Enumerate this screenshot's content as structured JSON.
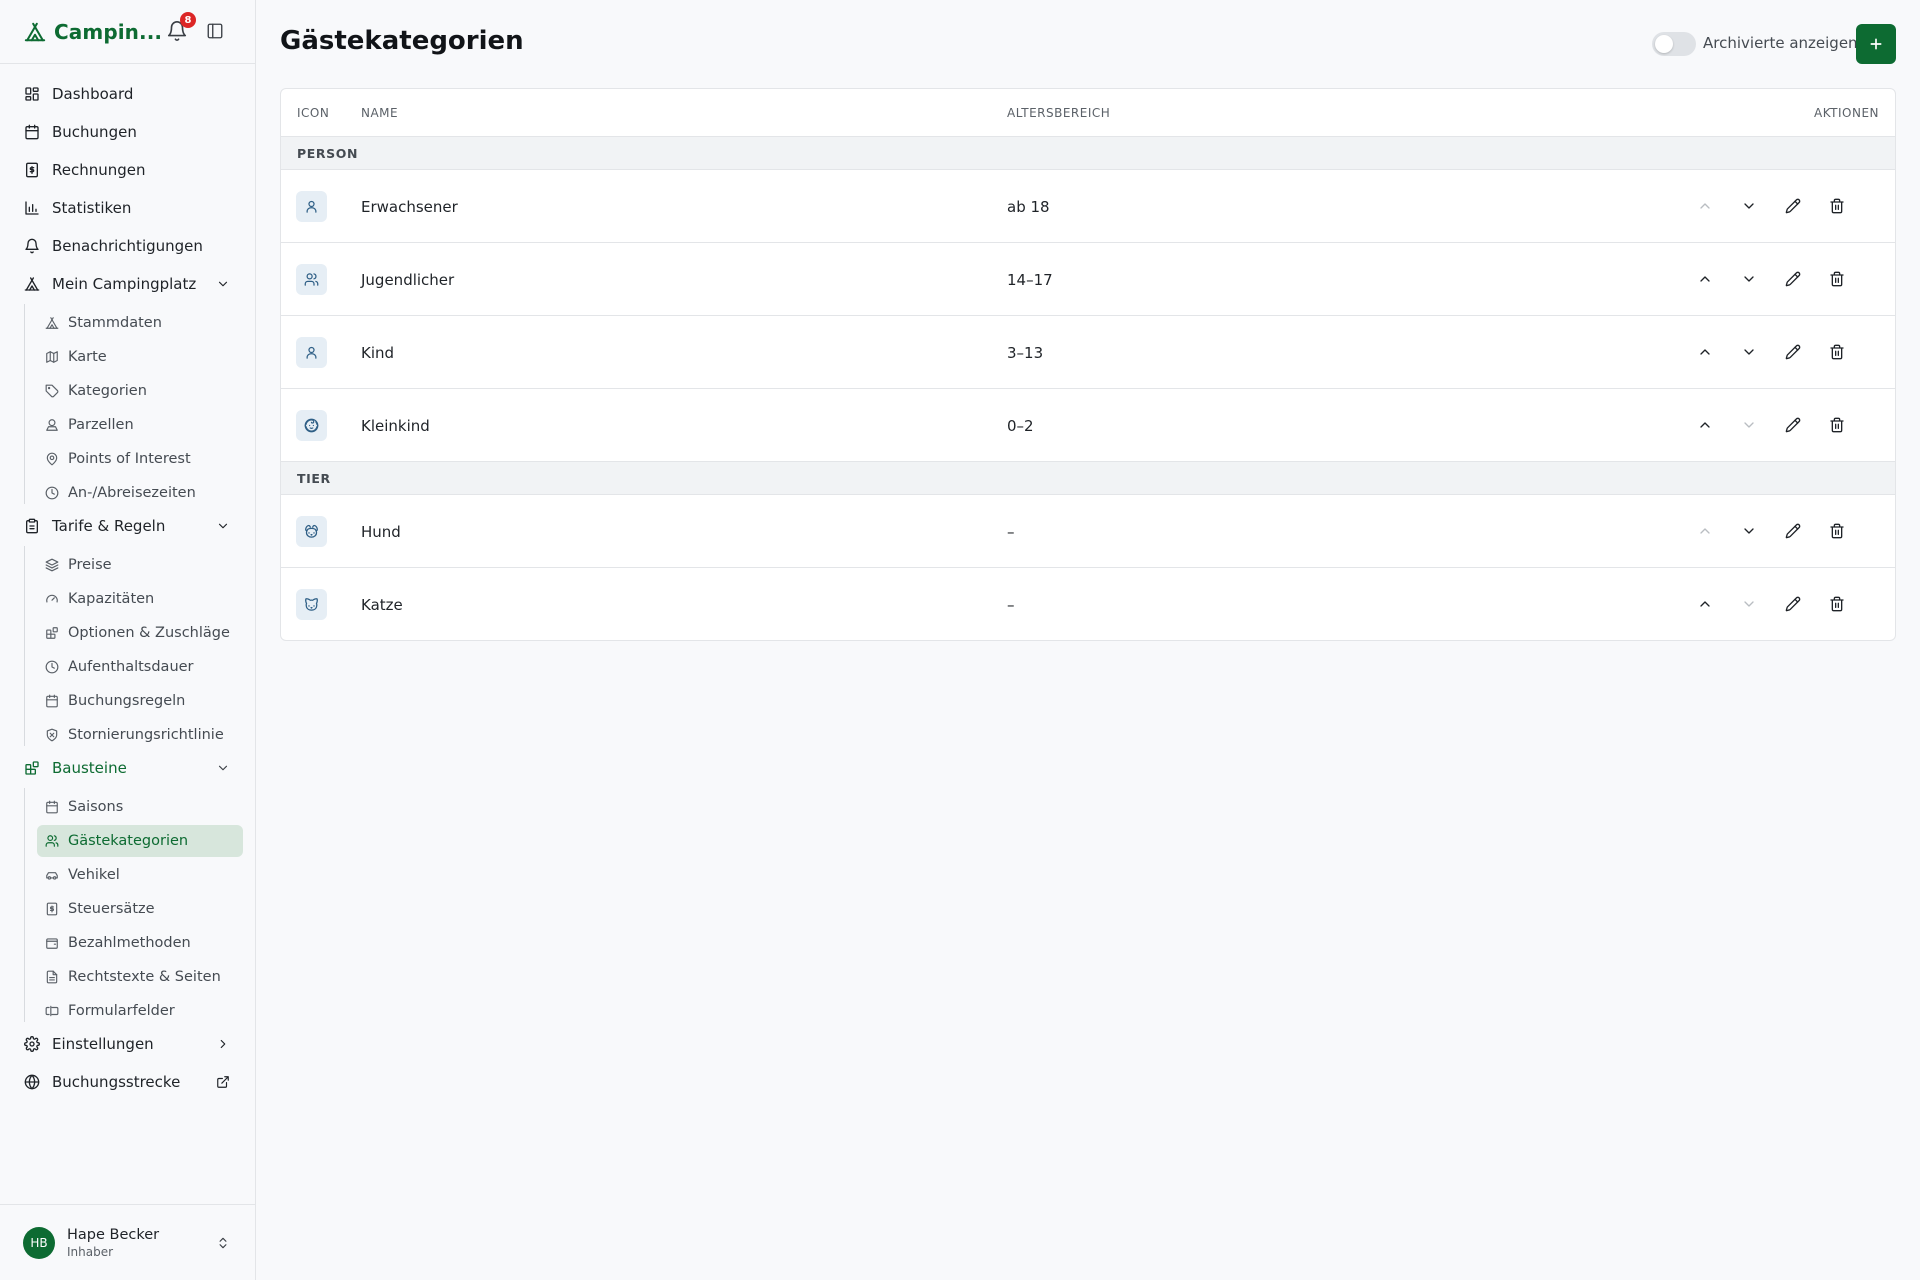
{
  "app": {
    "name": "Campin...",
    "notification_count": "8"
  },
  "nav": {
    "dashboard": "Dashboard",
    "buchungen": "Buchungen",
    "rechnungen": "Rechnungen",
    "statistiken": "Statistiken",
    "benachrichtigungen": "Benachrichtigungen",
    "mein_campingplatz": "Mein Campingplatz",
    "mein_sub": [
      "Stammdaten",
      "Karte",
      "Kategorien",
      "Parzellen",
      "Points of Interest",
      "An-/Abreisezeiten"
    ],
    "tarife": "Tarife & Regeln",
    "tarife_sub": [
      "Preise",
      "Kapazitäten",
      "Optionen & Zuschläge",
      "Aufenthaltsdauer",
      "Buchungsregeln",
      "Stornierungsrichtlinie"
    ],
    "bausteine": "Bausteine",
    "bausteine_sub": [
      "Saisons",
      "Gästekategorien",
      "Vehikel",
      "Steuersätze",
      "Bezahlmethoden",
      "Rechtstexte & Seiten",
      "Formularfelder"
    ],
    "einstellungen": "Einstellungen",
    "buchungsstrecke": "Buchungsstrecke"
  },
  "user": {
    "initials": "HB",
    "name": "Hape Becker",
    "role": "Inhaber"
  },
  "page": {
    "title": "Gästekategorien",
    "toggle_label": "Archivierte anzeigen",
    "add_label": "+"
  },
  "table": {
    "headers": {
      "icon": "ICON",
      "name": "NAME",
      "age": "ALTERSBEREICH",
      "actions": "AKTIONEN"
    },
    "groups": [
      {
        "label": "PERSON",
        "rows": [
          {
            "icon": "person-icon",
            "name": "Erwachsener",
            "age": "ab 18",
            "up_enabled": false,
            "down_enabled": true
          },
          {
            "icon": "users-icon",
            "name": "Jugendlicher",
            "age": "14–17",
            "up_enabled": true,
            "down_enabled": true
          },
          {
            "icon": "person-icon",
            "name": "Kind",
            "age": "3–13",
            "up_enabled": true,
            "down_enabled": true
          },
          {
            "icon": "baby-icon",
            "name": "Kleinkind",
            "age": "0–2",
            "up_enabled": true,
            "down_enabled": false
          }
        ]
      },
      {
        "label": "TIER",
        "rows": [
          {
            "icon": "dog-icon",
            "name": "Hund",
            "age": "–",
            "up_enabled": false,
            "down_enabled": true
          },
          {
            "icon": "cat-icon",
            "name": "Katze",
            "age": "–",
            "up_enabled": true,
            "down_enabled": false
          }
        ]
      }
    ]
  },
  "colors": {
    "brand": "#0d6b32",
    "badge": "#dc2626",
    "active_bg": "#d7e6dc"
  }
}
